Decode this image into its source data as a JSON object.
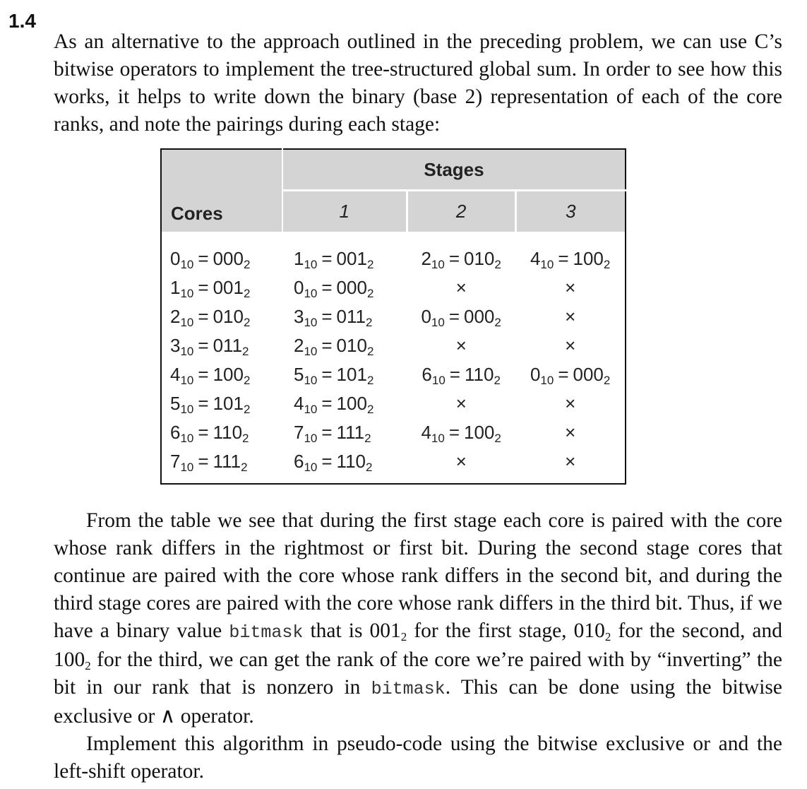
{
  "problem": {
    "number": "1.4",
    "intro": "As an alternative to the approach outlined in the preceding problem, we can use C’s bitwise operators to implement the tree-structured global sum. In order to see how this works, it helps to write down the binary (base 2) representation of each of the core ranks, and note the pairings during each stage:"
  },
  "table": {
    "header_group": "Stages",
    "cores_header": "Cores",
    "stage_headers": [
      "1",
      "2",
      "3"
    ],
    "cross": "×",
    "rows": [
      {
        "core": [
          "0",
          "10",
          "000",
          "2"
        ],
        "s1": [
          "1",
          "10",
          "001",
          "2"
        ],
        "s2": [
          "2",
          "10",
          "010",
          "2"
        ],
        "s3": [
          "4",
          "10",
          "100",
          "2"
        ]
      },
      {
        "core": [
          "1",
          "10",
          "001",
          "2"
        ],
        "s1": [
          "0",
          "10",
          "000",
          "2"
        ],
        "s2": null,
        "s3": null
      },
      {
        "core": [
          "2",
          "10",
          "010",
          "2"
        ],
        "s1": [
          "3",
          "10",
          "011",
          "2"
        ],
        "s2": [
          "0",
          "10",
          "000",
          "2"
        ],
        "s3": null
      },
      {
        "core": [
          "3",
          "10",
          "011",
          "2"
        ],
        "s1": [
          "2",
          "10",
          "010",
          "2"
        ],
        "s2": null,
        "s3": null
      },
      {
        "core": [
          "4",
          "10",
          "100",
          "2"
        ],
        "s1": [
          "5",
          "10",
          "101",
          "2"
        ],
        "s2": [
          "6",
          "10",
          "110",
          "2"
        ],
        "s3": [
          "0",
          "10",
          "000",
          "2"
        ]
      },
      {
        "core": [
          "5",
          "10",
          "101",
          "2"
        ],
        "s1": [
          "4",
          "10",
          "100",
          "2"
        ],
        "s2": null,
        "s3": null
      },
      {
        "core": [
          "6",
          "10",
          "110",
          "2"
        ],
        "s1": [
          "7",
          "10",
          "111",
          "2"
        ],
        "s2": [
          "4",
          "10",
          "100",
          "2"
        ],
        "s3": null
      },
      {
        "core": [
          "7",
          "10",
          "111",
          "2"
        ],
        "s1": [
          "6",
          "10",
          "110",
          "2"
        ],
        "s2": null,
        "s3": null
      }
    ]
  },
  "paragraph1": {
    "part1": "From the table we see that during the first stage each core is paired with the core whose rank differs in the rightmost or first bit. During the second stage cores that continue are paired with the core whose rank differs in the second bit, and during the third stage cores are paired with the core whose rank differs in the third bit. Thus, if we have a binary value ",
    "code1": "bitmask",
    "part2": " that is 001",
    "sub1": "2",
    "part3": " for the first stage, 010",
    "sub2": "2",
    "part4": " for the second, and 100",
    "sub3": "2",
    "part5": " for the third, we can get the rank of the core we’re paired with by “inverting” the bit in our rank that is nonzero in ",
    "code2": "bitmask",
    "part6": ". This can be done using the bitwise exclusive or ∧ operator."
  },
  "paragraph2": "Implement this algorithm in pseudo-code using the bitwise exclusive or and the left-shift operator."
}
